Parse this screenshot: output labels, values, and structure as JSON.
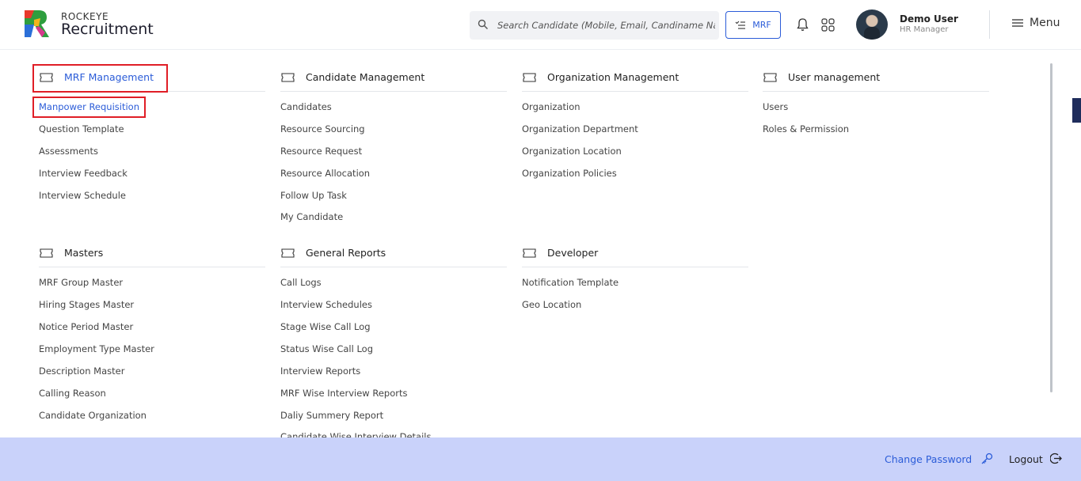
{
  "brand": {
    "small": "ROCKEYE",
    "name": "Recruitment"
  },
  "search": {
    "placeholder": "Search Candidate (Mobile, Email, Candiname Name)"
  },
  "header": {
    "mrf_label": "MRF",
    "user_name": "Demo User",
    "user_role": "HR Manager",
    "menu_label": "Menu"
  },
  "sections": [
    {
      "title": "MRF Management",
      "items": [
        "Manpower Requisition",
        "Question Template",
        "Assessments",
        "Interview Feedback",
        "Interview Schedule"
      ]
    },
    {
      "title": "Candidate Management",
      "items": [
        "Candidates",
        "Resource Sourcing",
        "Resource Request",
        "Resource Allocation",
        "Follow Up Task",
        "My Candidate"
      ]
    },
    {
      "title": "Organization Management",
      "items": [
        "Organization",
        "Organization Department",
        "Organization Location",
        "Organization Policies"
      ]
    },
    {
      "title": "User management",
      "items": [
        "Users",
        "Roles & Permission"
      ]
    },
    {
      "title": "Masters",
      "items": [
        "MRF Group Master",
        "Hiring Stages Master",
        "Notice Period Master",
        "Employment Type Master",
        "Description Master",
        "Calling Reason",
        "Candidate Organization"
      ]
    },
    {
      "title": "General Reports",
      "items": [
        "Call Logs",
        "Interview Schedules",
        "Stage Wise Call Log",
        "Status Wise Call Log",
        "Interview Reports",
        "MRF Wise Interview Reports",
        "Daliy Summery Report",
        "Candidate Wise Interview Details"
      ]
    },
    {
      "title": "Developer",
      "items": [
        "Notification Template",
        "Geo Location"
      ]
    }
  ],
  "footer": {
    "change_password": "Change Password",
    "logout": "Logout"
  },
  "colors": {
    "accent": "#2b5cd8",
    "highlight_box": "#e01e26",
    "footer_bg": "#c9d2fa"
  },
  "icons": {
    "search": "search-icon",
    "mrf": "list-check-icon",
    "bell": "bell-icon",
    "apps": "apps-grid-icon",
    "menu": "hamburger-icon",
    "section": "ticket-icon",
    "key": "key-icon",
    "logout": "logout-icon"
  }
}
